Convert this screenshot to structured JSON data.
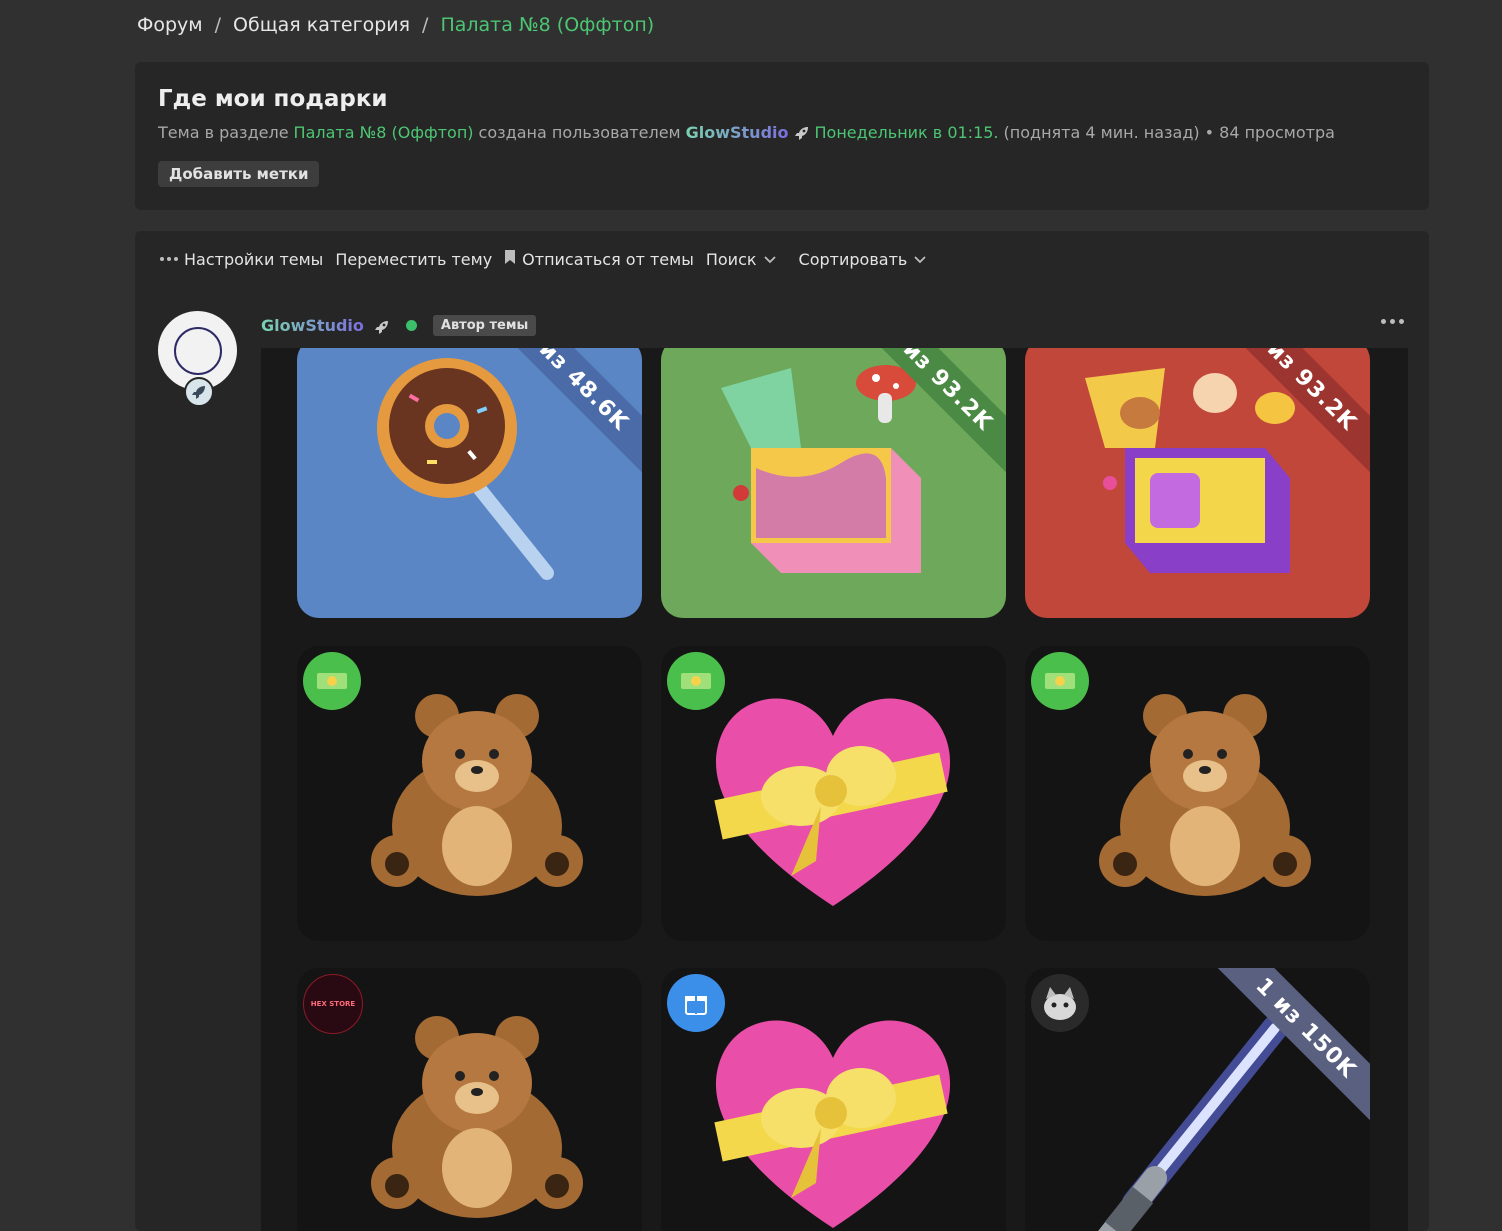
{
  "breadcrumb": {
    "items": [
      "Форум",
      "Общая категория"
    ],
    "current": "Палата №8 (Оффтоп)",
    "separator": "/"
  },
  "topic": {
    "title": "Где мои подарки",
    "meta_prefix": "Тема в разделе",
    "section": "Палата №8 (Оффтоп)",
    "created_by": "создана пользователем",
    "author": "GlowStudio",
    "date": "Понедельник в 01:15.",
    "bumped": "(поднята 4 мин. назад)",
    "views": "• 84 просмотра",
    "add_tags": "Добавить метки"
  },
  "toolbar": {
    "settings": "Настройки темы",
    "move": "Переместить тему",
    "unsubscribe": "Отписаться от темы",
    "search": "Поиск",
    "sort": "Сортировать"
  },
  "post": {
    "author": "GlowStudio",
    "author_badge": "Автор темы"
  },
  "gifts": {
    "row1": [
      {
        "name": "donut-lollipop",
        "ribbon": "из 48.6K",
        "bg": "#5b86c6",
        "ribbon_color": "#4a6aa8"
      },
      {
        "name": "jack-in-box-mushroom",
        "ribbon": "из 93.2K",
        "bg": "#6ea85a",
        "ribbon_color": "#4b8a45"
      },
      {
        "name": "jack-in-box-thumbs",
        "ribbon": "из 93.2K",
        "bg": "#c0473a",
        "ribbon_color": "#9c3530"
      }
    ],
    "row2": [
      {
        "name": "teddy-bear"
      },
      {
        "name": "heart-bow"
      },
      {
        "name": "teddy-bear"
      }
    ],
    "row3": [
      {
        "name": "teddy-bear",
        "badge_text": "HEX STORE"
      },
      {
        "name": "heart-bow"
      },
      {
        "name": "lightsaber",
        "ribbon": "1 из 150K",
        "ribbon_color": "#5a6180"
      }
    ]
  },
  "colors": {
    "accent_green": "#4cc673",
    "background": "#303030",
    "panel": "#262626"
  }
}
